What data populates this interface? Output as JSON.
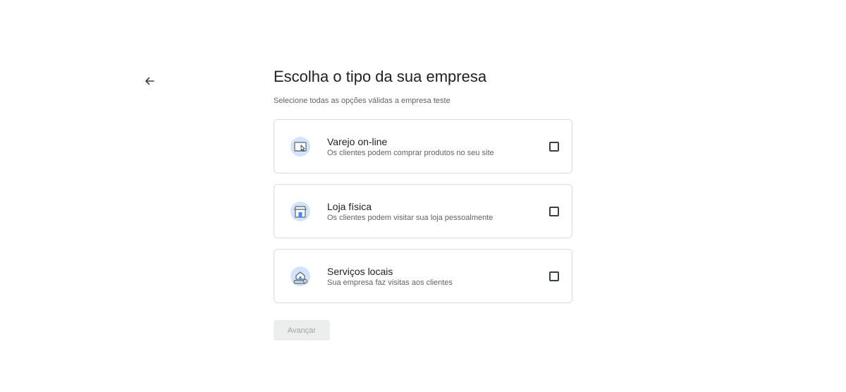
{
  "page": {
    "title": "Escolha o tipo da sua empresa",
    "subtitle": "Selecione todas as opções válidas a empresa teste"
  },
  "back": {
    "icon": "arrow-left-icon"
  },
  "options": [
    {
      "icon": "online-store-icon",
      "title": "Varejo on-line",
      "description": "Os clientes podem comprar produtos no seu site",
      "checked": false
    },
    {
      "icon": "storefront-icon",
      "title": "Loja física",
      "description": "Os clientes podem visitar sua loja pessoalmente",
      "checked": false
    },
    {
      "icon": "local-services-icon",
      "title": "Serviços locais",
      "description": "Sua empresa faz visitas aos clientes",
      "checked": false
    }
  ],
  "actions": {
    "next_label": "Avançar",
    "next_disabled": true
  },
  "colors": {
    "icon_circle": "#d2e3fc",
    "icon_accent": "#4285f4",
    "border": "#dadce0",
    "disabled_bg": "#eceded",
    "disabled_text": "#a0a3a6"
  }
}
